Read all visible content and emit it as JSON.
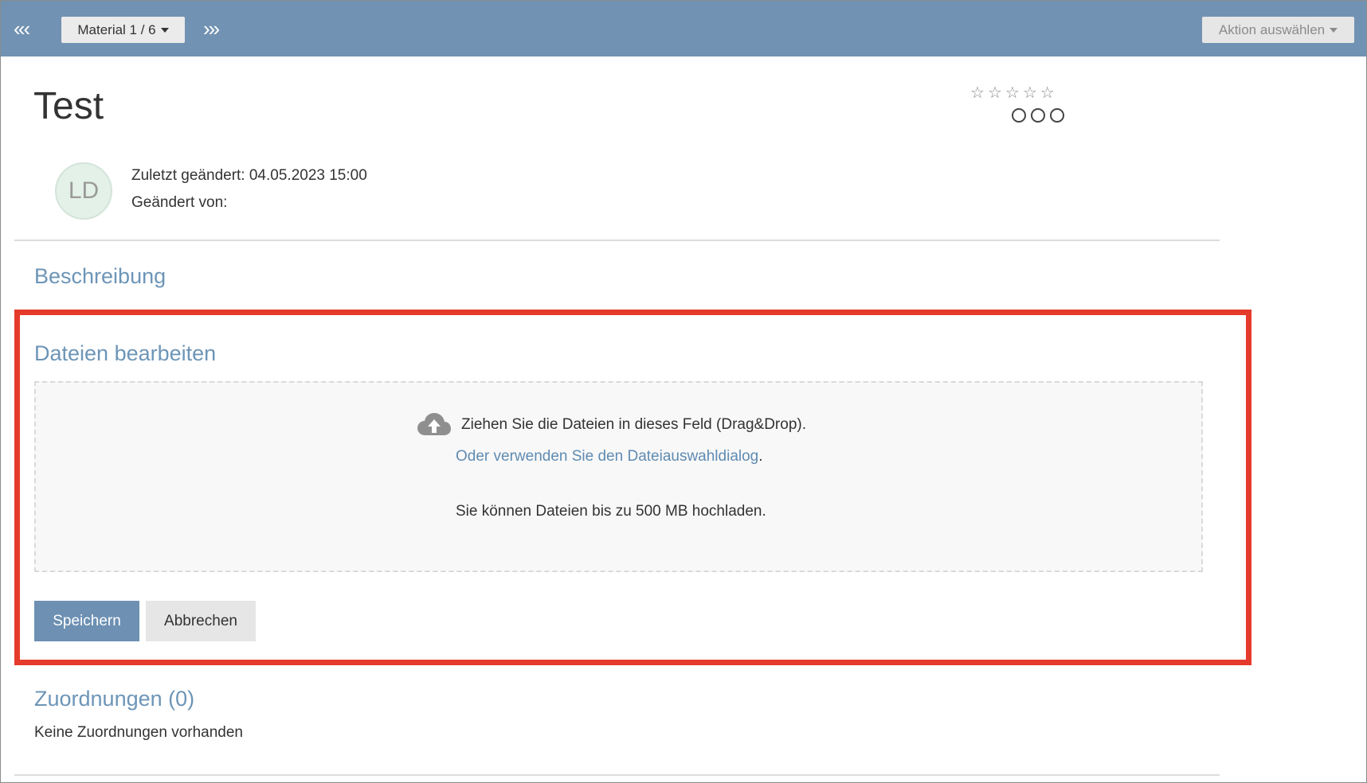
{
  "topbar": {
    "prev_icons": "«‹",
    "material_select": "Material 1 / 6",
    "next_icons": "›»",
    "action_select": "Aktion auswählen"
  },
  "item": {
    "title": "Test",
    "rating_stars": [
      "☆",
      "☆",
      "☆",
      "☆",
      "☆"
    ],
    "avatar_initials": "LD",
    "last_changed": "Zuletzt geändert: 04.05.2023 15:00",
    "changed_by": "Geändert von:"
  },
  "sections": {
    "description": "Beschreibung",
    "edit_files": "Dateien bearbeiten",
    "assignments": "Zuordnungen (0)",
    "no_assignments": "Keine Zuordnungen vorhanden"
  },
  "dropzone": {
    "icon": "cloud-upload-icon",
    "drag_text": "Ziehen Sie die Dateien in dieses Feld (Drag&Drop).",
    "dialog_link": "Oder verwenden Sie den Dateiauswahldialog",
    "dialog_suffix": ".",
    "limit_text": "Sie können Dateien bis zu 500 MB hochladen."
  },
  "buttons": {
    "save": "Speichern",
    "cancel": "Abbrechen"
  },
  "colors": {
    "topbar": "#7192b2",
    "heading": "#6d95b7",
    "highlight": "#e53b2b",
    "save_button": "#6d90b3"
  }
}
